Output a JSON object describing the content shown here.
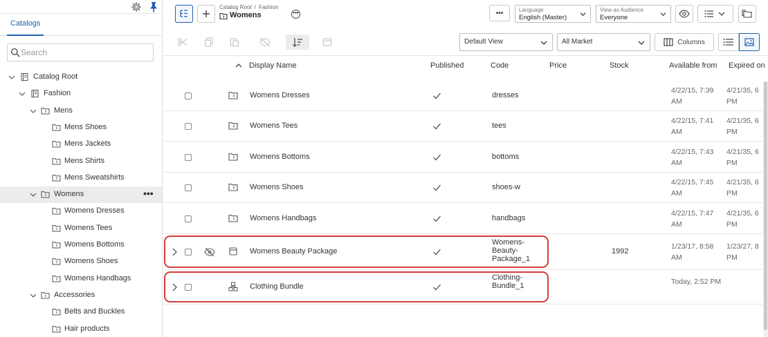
{
  "sidebar": {
    "tab": "Catalogs",
    "search": {
      "placeholder": "Search",
      "value": ""
    },
    "tree": [
      {
        "label": "Catalog Root",
        "level": 0,
        "icon": "catalog-icon",
        "expanded": true
      },
      {
        "label": "Fashion",
        "level": 1,
        "icon": "catalog-icon",
        "expanded": true
      },
      {
        "label": "Mens",
        "level": 2,
        "icon": "folder-icon",
        "expanded": true
      },
      {
        "label": "Mens Shoes",
        "level": 3,
        "icon": "folder-icon"
      },
      {
        "label": "Mens Jackets",
        "level": 3,
        "icon": "folder-icon"
      },
      {
        "label": "Mens Shirts",
        "level": 3,
        "icon": "folder-icon"
      },
      {
        "label": "Mens Sweatshirts",
        "level": 3,
        "icon": "folder-icon"
      },
      {
        "label": "Womens",
        "level": 2,
        "icon": "folder-icon",
        "expanded": true,
        "selected": true,
        "more": "•••"
      },
      {
        "label": "Womens Dresses",
        "level": 3,
        "icon": "folder-icon"
      },
      {
        "label": "Womens Tees",
        "level": 3,
        "icon": "folder-icon"
      },
      {
        "label": "Womens Bottoms",
        "level": 3,
        "icon": "folder-icon"
      },
      {
        "label": "Womens Shoes",
        "level": 3,
        "icon": "folder-icon"
      },
      {
        "label": "Womens Handbags",
        "level": 3,
        "icon": "folder-icon"
      },
      {
        "label": "Accessories",
        "level": 2,
        "icon": "folder-icon",
        "expanded": true
      },
      {
        "label": "Belts and Buckles",
        "level": 3,
        "icon": "folder-icon"
      },
      {
        "label": "Hair products",
        "level": 3,
        "icon": "folder-icon"
      }
    ]
  },
  "header": {
    "breadcrumb": [
      "Catalog Root",
      "Fashion"
    ],
    "breadcrumb_sep": "/",
    "title": "Womens",
    "more_label": "•••",
    "language": {
      "caption": "Language",
      "value": "English (Master)"
    },
    "audience": {
      "caption": "View as Audience",
      "value": "Everyone"
    }
  },
  "toolbar": {
    "view": "Default View",
    "market": "All Market",
    "columns_label": "Columns"
  },
  "table": {
    "columns": [
      "Display Name",
      "Published",
      "Code",
      "Price",
      "Stock",
      "Available from",
      "Expired on"
    ],
    "sort_indicator": "^",
    "rows": [
      {
        "name": "Womens Dresses",
        "published": true,
        "code": "dresses",
        "price": "",
        "stock": "",
        "available_from": "4/22/15, 7:39 AM",
        "expired_on": "4/21/35, 6 PM",
        "icon": "folder-icon"
      },
      {
        "name": "Womens Tees",
        "published": true,
        "code": "tees",
        "price": "",
        "stock": "",
        "available_from": "4/22/15, 7:41 AM",
        "expired_on": "4/21/35, 6 PM",
        "icon": "folder-icon"
      },
      {
        "name": "Womens Bottoms",
        "published": true,
        "code": "bottoms",
        "price": "",
        "stock": "",
        "available_from": "4/22/15, 7:43 AM",
        "expired_on": "4/21/35, 6 PM",
        "icon": "folder-icon"
      },
      {
        "name": "Womens Shoes",
        "published": true,
        "code": "shoes-w",
        "price": "",
        "stock": "",
        "available_from": "4/22/15, 7:45 AM",
        "expired_on": "4/21/35, 6 PM",
        "icon": "folder-icon"
      },
      {
        "name": "Womens Handbags",
        "published": true,
        "code": "handbags",
        "price": "",
        "stock": "",
        "available_from": "4/22/15, 7:47 AM",
        "expired_on": "4/21/35, 6 PM",
        "icon": "folder-icon"
      },
      {
        "name": "Womens Beauty Package",
        "published": true,
        "code": "Womens-Beauty-Package_1",
        "price": "",
        "stock": "1992",
        "available_from": "1/23/17, 8:58 AM",
        "expired_on": "1/23/27, 8 PM",
        "icon": "package-icon",
        "expandable": true,
        "hidden_icon": true,
        "highlighted": true
      },
      {
        "name": "Clothing Bundle",
        "published": true,
        "code": "Clothing-Bundle_1",
        "price": "",
        "stock": "",
        "available_from": "Today, 2:52 PM",
        "expired_on": "",
        "icon": "bundle-icon",
        "expandable": true,
        "highlighted": true
      }
    ]
  },
  "colors": {
    "accent": "#1f5fb0",
    "highlight": "#d33b3b",
    "selected_bg": "#ececec"
  }
}
